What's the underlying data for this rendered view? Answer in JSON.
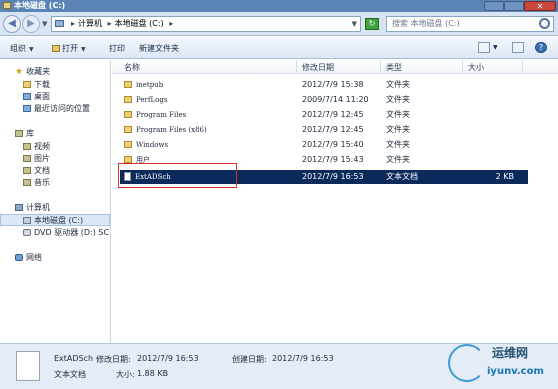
{
  "window": {
    "title": "本地磁盘 (C:)"
  },
  "address": {
    "crumbs": [
      "计算机",
      "本地磁盘 (C:)"
    ],
    "search_placeholder": "搜索 本地磁盘 (C:)"
  },
  "toolbar": {
    "organize": "组织",
    "open": "打开",
    "print": "打印",
    "new_folder": "新建文件夹"
  },
  "nav": {
    "favorites": "收藏夹",
    "downloads": "下载",
    "desktop": "桌面",
    "recent": "最近访问的位置",
    "libraries": "库",
    "videos": "视频",
    "pictures": "图片",
    "documents": "文档",
    "music": "音乐",
    "computer": "计算机",
    "local_disk": "本地磁盘 (C:)",
    "dvd": "DVD 驱动器 (D:) SC",
    "network": "网络"
  },
  "columns": {
    "name": "名称",
    "date": "修改日期",
    "type": "类型",
    "size": "大小"
  },
  "files": [
    {
      "name": "inetpub",
      "date": "2012/7/9 15:38",
      "type": "文件夹",
      "size": ""
    },
    {
      "name": "PerfLogs",
      "date": "2009/7/14 11:20",
      "type": "文件夹",
      "size": ""
    },
    {
      "name": "Program Files",
      "date": "2012/7/9 12:45",
      "type": "文件夹",
      "size": ""
    },
    {
      "name": "Program Files (x86)",
      "date": "2012/7/9 12:45",
      "type": "文件夹",
      "size": ""
    },
    {
      "name": "Windows",
      "date": "2012/7/9 15:40",
      "type": "文件夹",
      "size": ""
    },
    {
      "name": "用户",
      "date": "2012/7/9 15:43",
      "type": "文件夹",
      "size": ""
    },
    {
      "name": "ExtADSch",
      "date": "2012/7/9 16:53",
      "type": "文本文档",
      "size": "2 KB"
    }
  ],
  "details": {
    "name": "ExtADSch",
    "modified_label": "修改日期:",
    "modified": "2012/7/9 16:53",
    "created_label": "创建日期:",
    "created": "2012/7/9 16:53",
    "type": "文本文档",
    "size_label": "大小:",
    "size": "1.88 KB"
  },
  "watermark": {
    "cn": "运维网",
    "en": "iyunv.com"
  }
}
